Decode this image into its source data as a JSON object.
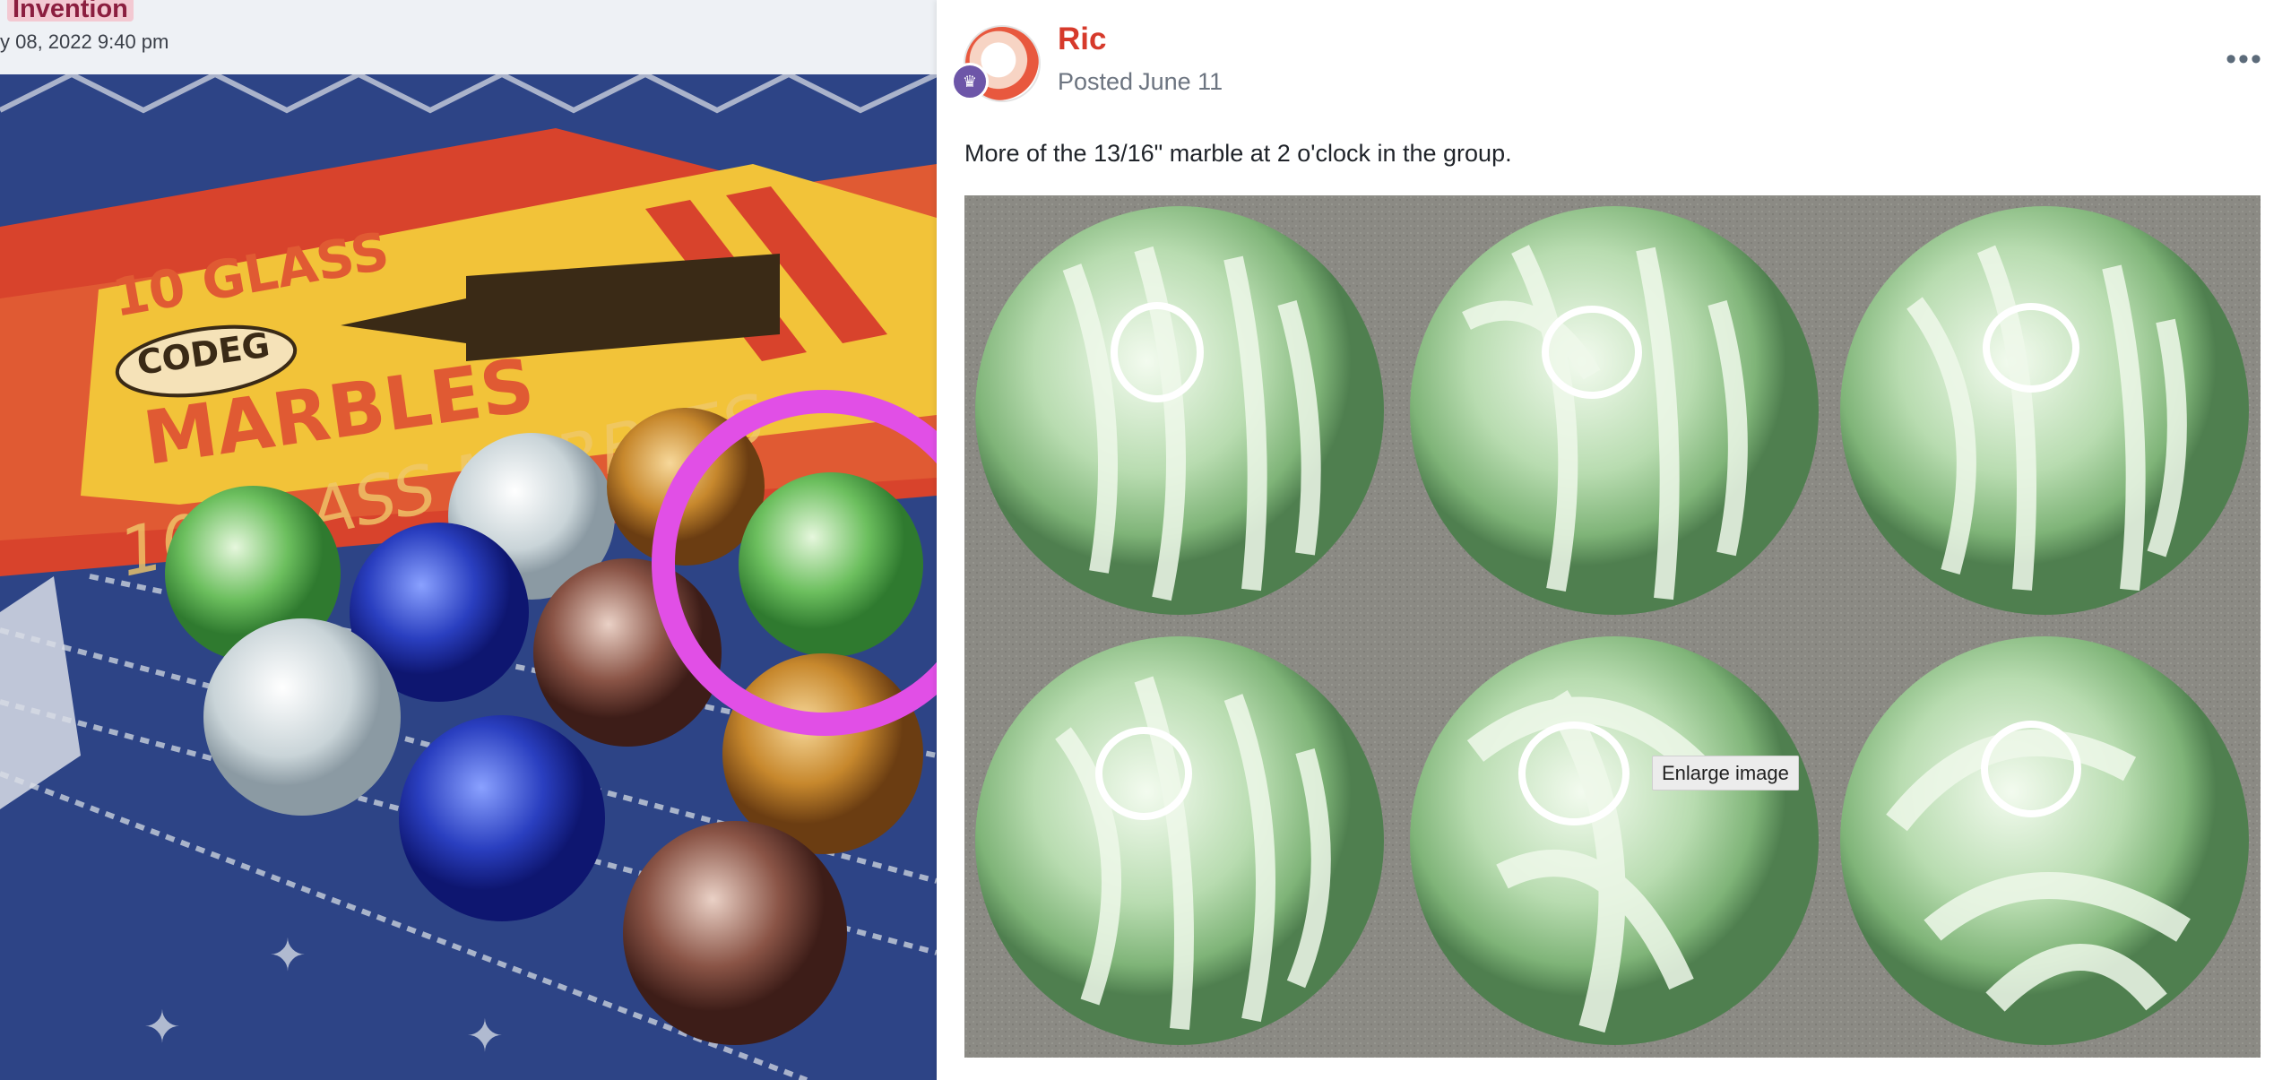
{
  "left_post": {
    "tag": "Invention",
    "date": "y 08, 2022 9:40 pm",
    "photo_box_text": {
      "line1": "10 GLASS",
      "brand": "CODEG",
      "line2": "MARBLES",
      "line3": "10 GLASS MARBLES"
    }
  },
  "post": {
    "author": "Ric",
    "posted_label": "Posted",
    "posted_date": "June 11",
    "menu_icon": "ellipsis-icon",
    "body": "More of the 13/16\" marble at 2 o'clock in the group.",
    "image_tooltip": "Enlarge image"
  },
  "colors": {
    "author": "#d63a2b",
    "highlight_circle": "#e14fe6",
    "badge": "#6d56a8"
  }
}
